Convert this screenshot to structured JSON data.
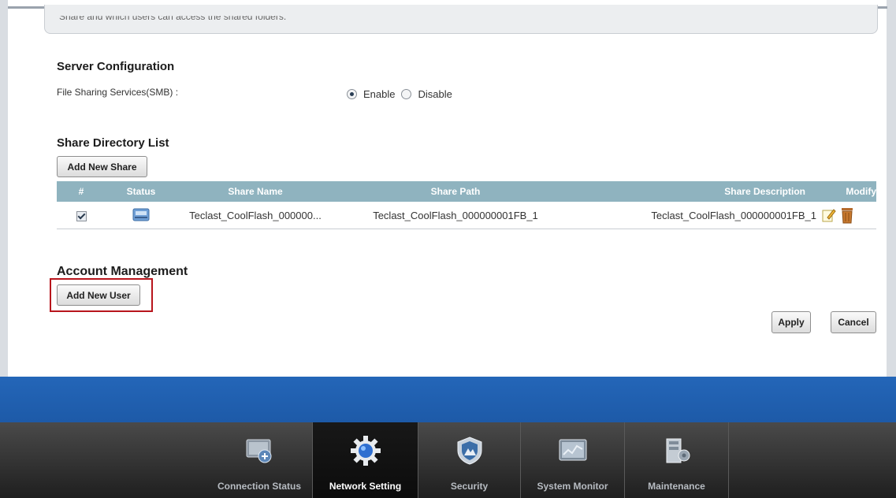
{
  "info_box": {
    "text": "Share and which users can access the shared folders."
  },
  "server_config": {
    "title": "Server Configuration",
    "smb_label": "File Sharing Services(SMB) :",
    "enable_label": "Enable",
    "disable_label": "Disable",
    "selected": "Enable"
  },
  "share_list": {
    "title": "Share Directory List",
    "add_button": "Add New Share",
    "columns": [
      "#",
      "Status",
      "Share Name",
      "Share Path",
      "Share Description",
      "Modify"
    ],
    "rows": [
      {
        "checked": true,
        "name": "Teclast_CoolFlash_000000...",
        "path": "Teclast_CoolFlash_000000001FB_1",
        "description": "Teclast_CoolFlash_000000001FB_1"
      }
    ]
  },
  "account": {
    "title": "Account Management",
    "add_button": "Add New User"
  },
  "actions": {
    "apply": "Apply",
    "cancel": "Cancel"
  },
  "nav": {
    "items": [
      {
        "label": "Connection Status",
        "icon": "connection-status-icon"
      },
      {
        "label": "Network Setting",
        "icon": "gear-icon",
        "active": true
      },
      {
        "label": "Security",
        "icon": "shield-icon"
      },
      {
        "label": "System Monitor",
        "icon": "monitor-chart-icon"
      },
      {
        "label": "Maintenance",
        "icon": "maintenance-icon"
      }
    ]
  },
  "colors": {
    "table_header": "#8fb3bf",
    "blue_band": "#2466b8",
    "nav_bg": "#2e2e2e",
    "highlight": "#b8151c"
  }
}
